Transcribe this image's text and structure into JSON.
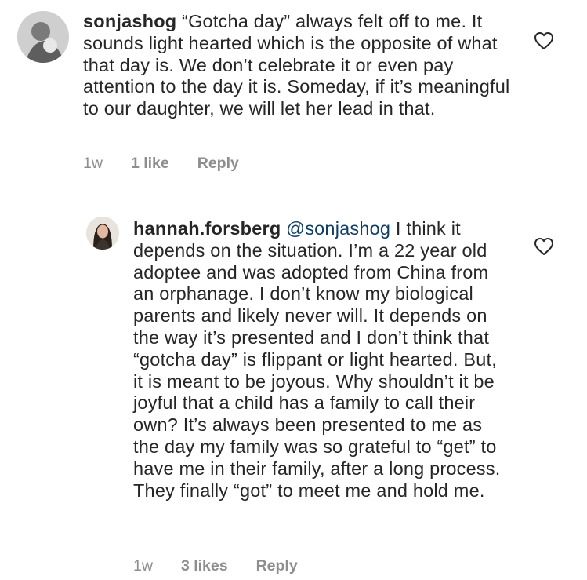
{
  "comments": [
    {
      "username": "sonjashog",
      "text": " “Gotcha day” always felt off to me. It sounds light hearted which is the opposite of what that day is. We don’t celebrate it or even pay attention to the day it is. Someday,  if it’s meaningful to our daughter, we will let her lead in that.",
      "time": "1w",
      "likes": "1 like",
      "reply": "Reply"
    },
    {
      "username": "hannah.forsberg",
      "mention": "@sonjashog",
      "text": " I think it depends on the situation. I’m a 22 year old adoptee and was adopted from China from an orphanage. I don’t know my biological parents and likely never will. It depends on the way it’s presented and I don’t think that “gotcha day” is flippant or light hearted. But, it is meant to be joyous. Why shouldn’t it be joyful that a child has a family to call their own? It’s always been presented to me as the day my family was so grateful to “get” to have me in their family, after a long process. They finally “got” to meet me and hold me.",
      "time": "1w",
      "likes": "3 likes",
      "reply": "Reply"
    }
  ],
  "icons": {
    "like": "heart-outline-icon",
    "avatar": "profile-photo"
  },
  "colors": {
    "text": "#262626",
    "meta": "#8e8e8e",
    "mention": "#0f3e64"
  }
}
